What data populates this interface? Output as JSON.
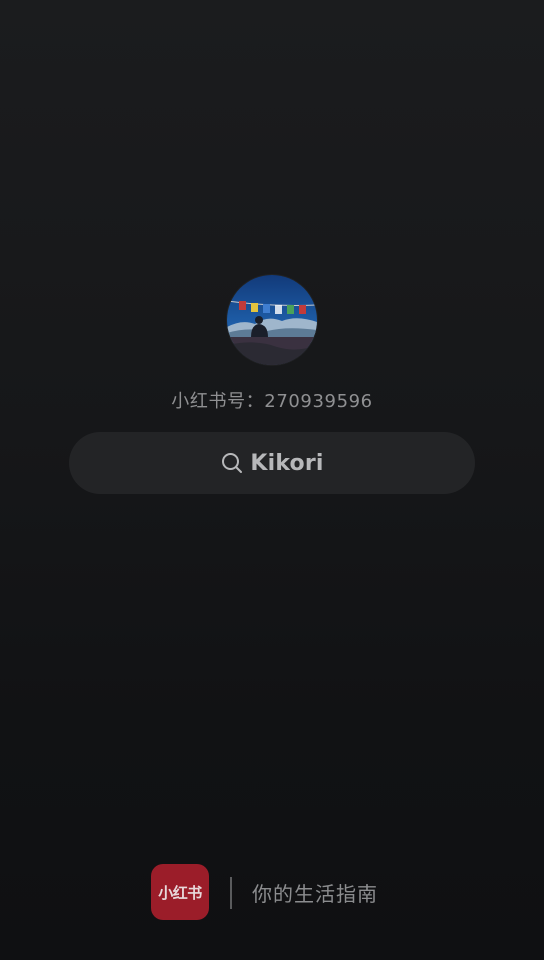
{
  "profile": {
    "avatar_icon": "avatar-photo",
    "id_text": "小红书号：270939596"
  },
  "search": {
    "icon": "search-icon",
    "term": "Kikori"
  },
  "footer": {
    "logo_text": "小红书",
    "slogan": "你的生活指南",
    "brand_color": "#9b1d29"
  }
}
